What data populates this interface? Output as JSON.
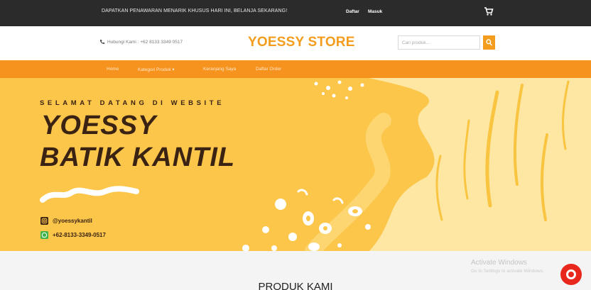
{
  "topbar": {
    "promo": "DAPATKAN PENAWARAN MENARIK KHUSUS HARI INI, BELANJA SEKARANG!",
    "register_label": "Daftar",
    "login_label": "Masuk",
    "cart_icon": "cart-icon"
  },
  "header": {
    "phone_label": "Hubungi Kami : +62 8133 3349 0517",
    "phone_icon": "phone-icon",
    "brand": "YOESSY STORE",
    "search_placeholder": "Cari produk...",
    "search_icon": "search-icon"
  },
  "nav": {
    "items": [
      {
        "label": "Home"
      },
      {
        "label": "Kategori Produk ▾"
      },
      {
        "label": "Keranjang Saya"
      },
      {
        "label": "Daftar Order"
      }
    ]
  },
  "hero": {
    "welcome": "SELAMAT DATANG DI WEBSITE",
    "title_line1": "YOESSY",
    "title_line2": "BATIK KANTIL",
    "instagram": "@yoessykantil",
    "whatsapp": "+62-8133-3349-0517",
    "colors": {
      "background": "#fcc64b",
      "accent": "#3a2313"
    }
  },
  "section": {
    "heading": "PRODUK KAMI"
  },
  "overlay": {
    "activate_title": "Activate Windows",
    "activate_sub": "Go to Settings to activate Windows."
  },
  "colors": {
    "brand": "#f39c1d",
    "nav": "#f6921e",
    "topbar": "#2b2b2b"
  }
}
